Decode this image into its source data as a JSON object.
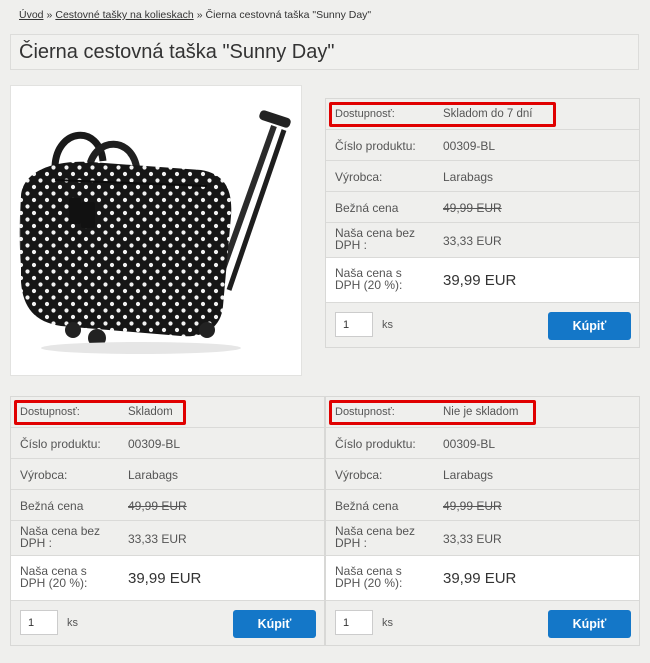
{
  "breadcrumb": {
    "home": "Úvod",
    "category": "Cestovné tašky na kolieskach",
    "current": "Čierna cestovná taška \"Sunny Day\"",
    "separator": "»"
  },
  "page_title": "Čierna cestovná taška \"Sunny Day\"",
  "product_image_alt": "Black polka dot rolling travel bag",
  "labels": {
    "availability": "Dostupnosť:",
    "product_number": "Číslo produktu:",
    "manufacturer": "Výrobca:",
    "regular_price": "Bežná cena",
    "price_no_vat": "Naša cena bez DPH :",
    "price_vat": "Naša cena s DPH (20 %):",
    "qty_unit": "ks",
    "buy": "Kúpiť"
  },
  "panels": [
    {
      "availability": "Skladom do 7 dní",
      "product_number": "00309-BL",
      "manufacturer": "Larabags",
      "regular_price": "49,99 EUR",
      "price_no_vat": "33,33 EUR",
      "price_vat": "39,99 EUR",
      "qty": "1"
    },
    {
      "availability": "Skladom",
      "product_number": "00309-BL",
      "manufacturer": "Larabags",
      "regular_price": "49,99 EUR",
      "price_no_vat": "33,33 EUR",
      "price_vat": "39,99 EUR",
      "qty": "1"
    },
    {
      "availability": "Nie je skladom",
      "product_number": "00309-BL",
      "manufacturer": "Larabags",
      "regular_price": "49,99 EUR",
      "price_no_vat": "33,33 EUR",
      "price_vat": "39,99 EUR",
      "qty": "1"
    }
  ],
  "colors": {
    "highlight": "#e00000",
    "buy_button": "#1477c8"
  }
}
